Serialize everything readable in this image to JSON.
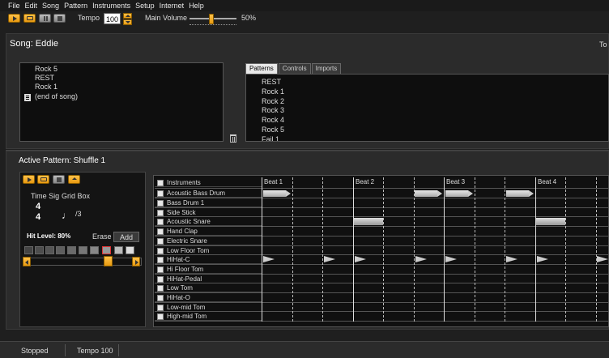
{
  "menu": [
    "File",
    "Edit",
    "Song",
    "Pattern",
    "Instruments",
    "Setup",
    "Internet",
    "Help"
  ],
  "toolbar": {
    "tempo_label": "Tempo",
    "tempo_value": "100",
    "volume_label": "Main Volume",
    "volume_value": "50%",
    "volume_level": 0.5
  },
  "song": {
    "title": "Song: Eddie",
    "cut_text": "To",
    "entries": [
      "Rock 5",
      "REST",
      "Rock 1",
      "(end of song)"
    ]
  },
  "library": {
    "tabs": [
      "Patterns",
      "Controls",
      "Imports"
    ],
    "active_tab": "Patterns",
    "patterns": [
      "REST",
      "Rock 1",
      "Rock 2",
      "Rock 3",
      "Rock 4",
      "Rock 5",
      "Fail 1"
    ]
  },
  "pattern": {
    "title": "Active Pattern: Shuffle 1",
    "time_sig_label": "Time Sig",
    "time_sig_top": "4",
    "time_sig_bottom": "4",
    "grid_box_label": "Grid Box",
    "grid_box_value": "/3",
    "hit_level_label": "Hit Level: 80%",
    "hit_level": 0.8,
    "erase_label": "Erase",
    "add_label": "Add"
  },
  "grid": {
    "instruments_header": "Instruments",
    "beats": [
      "Beat 1",
      "Beat 2",
      "Beat 3",
      "Beat 4"
    ],
    "instruments": [
      "Acoustic Bass Drum",
      "Bass Drum 1",
      "Side Stick",
      "Acoustic Snare",
      "Hand Clap",
      "Electric Snare",
      "Low Floor Tom",
      "HiHat-C",
      "Hi Floor Tom",
      "HiHat-Pedal",
      "Low Tom",
      "HiHat-O",
      "Low-mid Tom",
      "High-mid Tom"
    ]
  },
  "status": {
    "state": "Stopped",
    "tempo": "Tempo 100"
  }
}
